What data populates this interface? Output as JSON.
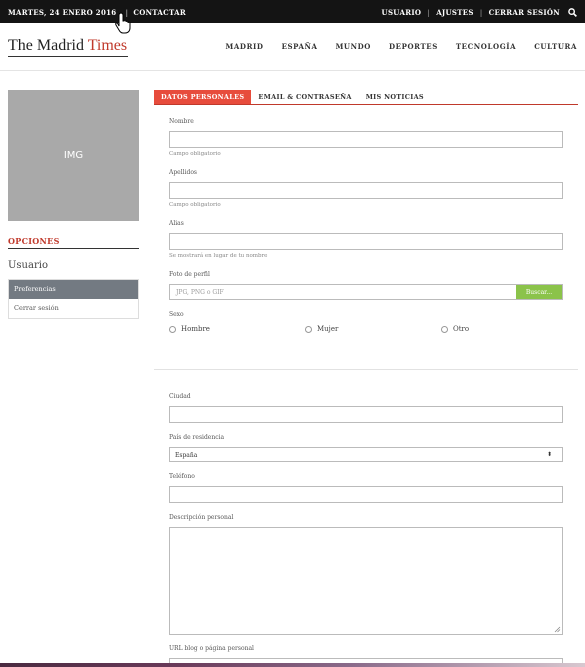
{
  "topbar": {
    "date": "MARTES, 24 ENERO 2016",
    "contact": "CONTACTAR",
    "user": "USUARIO",
    "settings": "AJUSTES",
    "logout": "CERRAR SESIÓN"
  },
  "logo": {
    "part1": "The Madrid ",
    "part2": "Times"
  },
  "nav": [
    "MADRID",
    "ESPAÑA",
    "MUNDO",
    "DEPORTES",
    "TECNOLOGÍA",
    "CULTURA"
  ],
  "sidebar": {
    "image_label": "IMG",
    "options_title": "OPCIONES",
    "section_title": "Usuario",
    "items": [
      {
        "label": "Preferencias"
      },
      {
        "label": "Cerrar sesión"
      }
    ]
  },
  "tabs": [
    "DATOS PERSONALES",
    "EMAIL & CONTRASEÑA",
    "MIS NOTICIAS"
  ],
  "form": {
    "nombre": {
      "label": "Nombre",
      "help": "Campo obligatorio",
      "value": ""
    },
    "apellidos": {
      "label": "Apellidos",
      "help": "Campo obligatorio",
      "value": ""
    },
    "alias": {
      "label": "Alias",
      "help": "Se mostrará en lugar de tu nombre",
      "value": ""
    },
    "foto": {
      "label": "Foto de perfil",
      "placeholder": "JPG, PNG o GIF",
      "button": "Buscar..."
    },
    "sexo": {
      "label": "Sexo",
      "options": [
        "Hombre",
        "Mujer",
        "Otro"
      ]
    },
    "ciudad": {
      "label": "Ciudad",
      "value": ""
    },
    "pais": {
      "label": "País de residencia",
      "value": "España"
    },
    "telefono": {
      "label": "Teléfono",
      "value": ""
    },
    "descripcion": {
      "label": "Descripción personal",
      "value": ""
    },
    "url": {
      "label": "URL blog o página personal",
      "value": ""
    }
  },
  "colors": {
    "accent": "#e74c3c",
    "button_green": "#8bc34a",
    "topbar": "#141414"
  }
}
